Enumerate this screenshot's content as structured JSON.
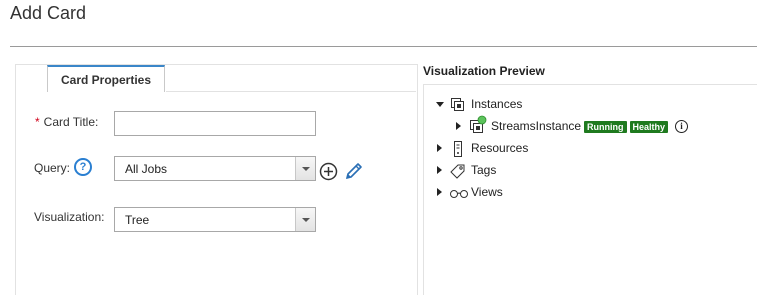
{
  "page": {
    "title": "Add Card"
  },
  "card_properties": {
    "tab_label": "Card Properties",
    "card_title": {
      "label": "Card Title:",
      "required_marker": "*",
      "value": ""
    },
    "query": {
      "label": "Query:",
      "help_glyph": "?",
      "selected": "All Jobs",
      "add_icon": "plus-circle-icon",
      "edit_icon": "pencil-icon"
    },
    "visualization": {
      "label": "Visualization:",
      "selected": "Tree"
    }
  },
  "preview": {
    "title": "Visualization Preview",
    "tree": [
      {
        "label": "Instances",
        "expanded": true,
        "icon": "instances-icon"
      },
      {
        "label": "StreamsInstance",
        "icon": "instance-status-icon",
        "badges": [
          "Running",
          "Healthy"
        ],
        "info_glyph": "i"
      },
      {
        "label": "Resources",
        "expanded": false,
        "icon": "resource-icon"
      },
      {
        "label": "Tags",
        "expanded": false,
        "icon": "tag-icon"
      },
      {
        "label": "Views",
        "expanded": false,
        "icon": "glasses-icon"
      }
    ],
    "badge_color": "#1f7a1f",
    "status_dot_color": "#5cc35c"
  },
  "colors": {
    "tab_accent": "#3a86c8",
    "help_icon": "#2a7fd1",
    "required": "#d0021b"
  }
}
